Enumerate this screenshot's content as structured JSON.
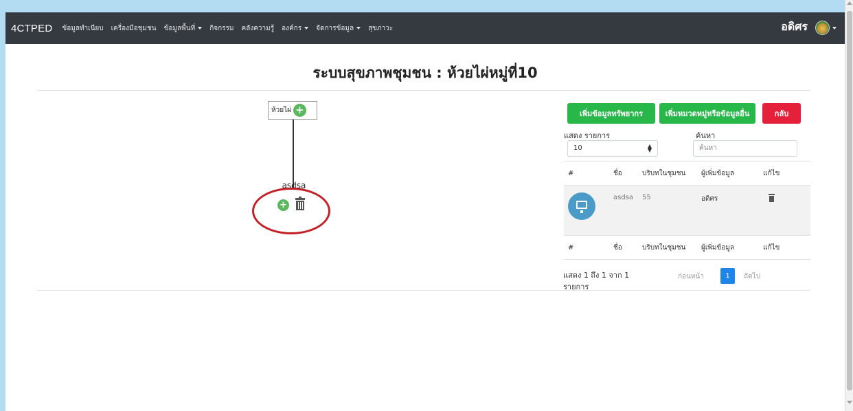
{
  "navbar": {
    "brand": "4CTPED",
    "items": [
      {
        "label": "ข้อมูลทำเนียบ",
        "dropdown": false
      },
      {
        "label": "เครื่องมือชุมชน",
        "dropdown": false
      },
      {
        "label": "ข้อมูลพื้นที่",
        "dropdown": true
      },
      {
        "label": "กิจกรรม",
        "dropdown": false
      },
      {
        "label": "คลังความรู้",
        "dropdown": false
      },
      {
        "label": "องค์กร",
        "dropdown": true
      },
      {
        "label": "จัดการข้อมูล",
        "dropdown": true
      },
      {
        "label": "สุขภาวะ",
        "dropdown": false
      }
    ],
    "user_name": "อดิศร"
  },
  "page": {
    "title": "ระบบสุขภาพชุมชน : ห้วยไผ่หมู่ที่10"
  },
  "tree": {
    "root_label": "ห้วยไผ่",
    "child_label": "asdsa"
  },
  "buttons": {
    "add_resource": "เพิ่มข้อมูลทรัพยากร",
    "add_category": "เพิ่มหมวดหมู่หรือข้อมูลอื่น",
    "back": "กลับ"
  },
  "table_controls": {
    "show_label": "แสดง รายการ",
    "page_size": "10",
    "search_label": "ค้นหา",
    "search_placeholder": "ค้นหา"
  },
  "table": {
    "columns": [
      "#",
      "ชื่อ",
      "บริบทในชุมชน",
      "ผู้เพิ่มข้อมูล",
      "แก้ไข"
    ],
    "rows": [
      {
        "name": "asdsa",
        "context": "55",
        "added_by": "อดิศร"
      }
    ]
  },
  "pagination": {
    "info": "แสดง 1 ถึง 1 จาก 1 รายการ",
    "prev": "ก่อนหน้า",
    "current": "1",
    "next": "ถัดไป"
  },
  "colors": {
    "navbar": "#343a40",
    "green_button": "#28b84a",
    "red_button": "#e5203a",
    "page_active": "#1e86e8",
    "highlight_ring": "#c52027"
  }
}
